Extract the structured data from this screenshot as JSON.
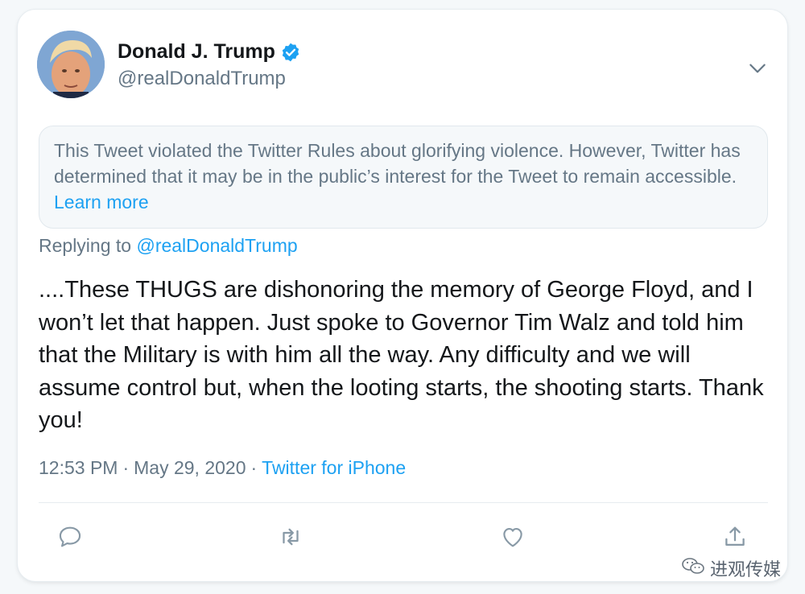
{
  "tweet": {
    "author_name": "Donald J. Trump",
    "handle": "@realDonaldTrump",
    "notice_text": "This Tweet violated the Twitter Rules about glorifying violence. However, Twitter has determined that it may be in the public’s interest for the Tweet to remain accessible.",
    "notice_link": "Learn more",
    "replying_prefix": "Replying to",
    "replying_handle": "@realDonaldTrump",
    "body": "....These THUGS are dishonoring the memory of George Floyd, and I won’t let that happen. Just spoke to Governor Tim Walz and told him that the Military is with him all the way. Any difficulty and we will assume control but, when the looting starts, the shooting starts. Thank you!",
    "time": "12:53 PM",
    "separator": "·",
    "date": "May 29, 2020",
    "source": "Twitter for iPhone"
  },
  "icons": {
    "verified": "verified-badge-icon",
    "menu": "chevron-down-icon",
    "reply": "reply-icon",
    "retweet": "retweet-icon",
    "like": "like-icon",
    "share": "share-icon",
    "watermark": "wechat-icon"
  },
  "watermark": {
    "text": "进观传媒"
  },
  "colors": {
    "accent": "#1da1f2",
    "text_primary": "#14171a",
    "text_secondary": "#657786",
    "notice_bg": "#f5f8fa"
  }
}
